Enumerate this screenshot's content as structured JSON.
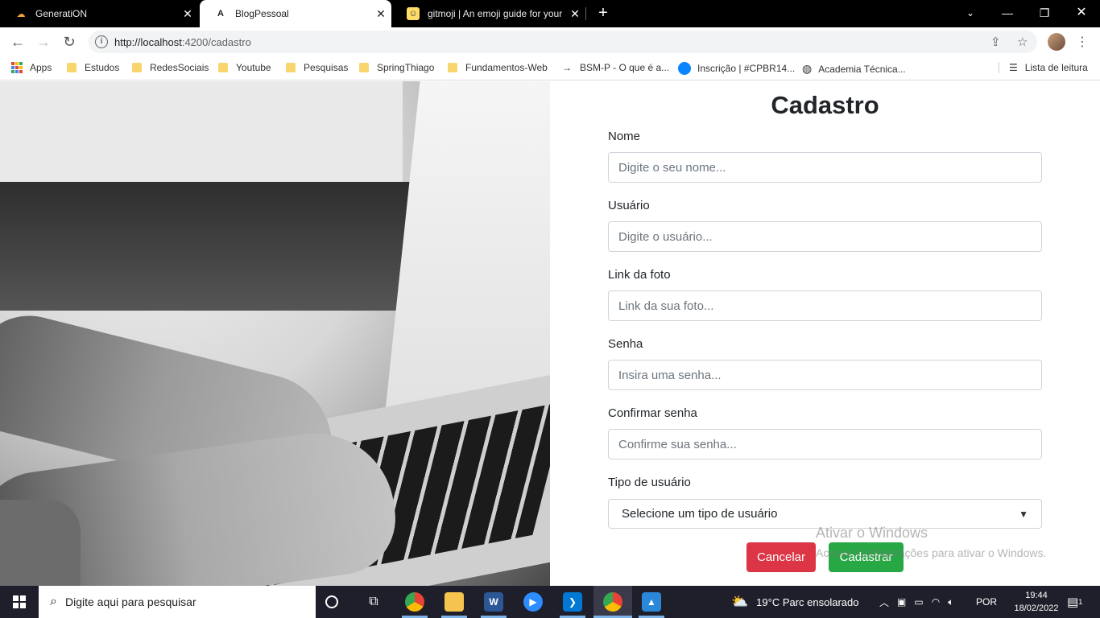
{
  "tabs": [
    {
      "title": "GeneratiON",
      "icon": "cloud-icon",
      "active": false
    },
    {
      "title": "BlogPessoal",
      "icon": "angular-icon",
      "active": true
    },
    {
      "title": "gitmoji | An emoji guide for your",
      "icon": "gitmoji-icon",
      "active": false
    }
  ],
  "address": {
    "url_host": "http://localhost",
    "url_rest": ":4200/cadastro"
  },
  "bookmarks": {
    "apps": "Apps",
    "items": [
      "Estudos",
      "RedesSociais",
      "Youtube",
      "Pesquisas",
      "SpringThiago",
      "Fundamentos-Web",
      "BSM-P - O que é a...",
      "Inscrição | #CPBR14...",
      "Academia Técnica..."
    ],
    "reading_list": "Lista de leitura"
  },
  "form": {
    "title": "Cadastro",
    "fields": [
      {
        "label": "Nome",
        "placeholder": "Digite o seu nome..."
      },
      {
        "label": "Usuário",
        "placeholder": "Digite o usuário..."
      },
      {
        "label": "Link da foto",
        "placeholder": "Link da sua foto..."
      },
      {
        "label": "Senha",
        "placeholder": "Insira uma senha..."
      },
      {
        "label": "Confirmar senha",
        "placeholder": "Confirme sua senha..."
      }
    ],
    "type_label": "Tipo de usuário",
    "type_selected": "Selecione um tipo de usuário",
    "cancel": "Cancelar",
    "submit": "Cadastrar"
  },
  "watermark": {
    "line1": "Ativar o Windows",
    "line2": "Acesse Configurações para ativar o Windows."
  },
  "taskbar": {
    "search_placeholder": "Digite aqui para pesquisar",
    "weather": "19°C  Parc ensolarado",
    "language": "POR",
    "time": "19:44",
    "date": "18/02/2022",
    "notifications": "1"
  },
  "colors": {
    "danger": "#dc3545",
    "success": "#28a745",
    "taskbar": "#1f1f2b"
  }
}
